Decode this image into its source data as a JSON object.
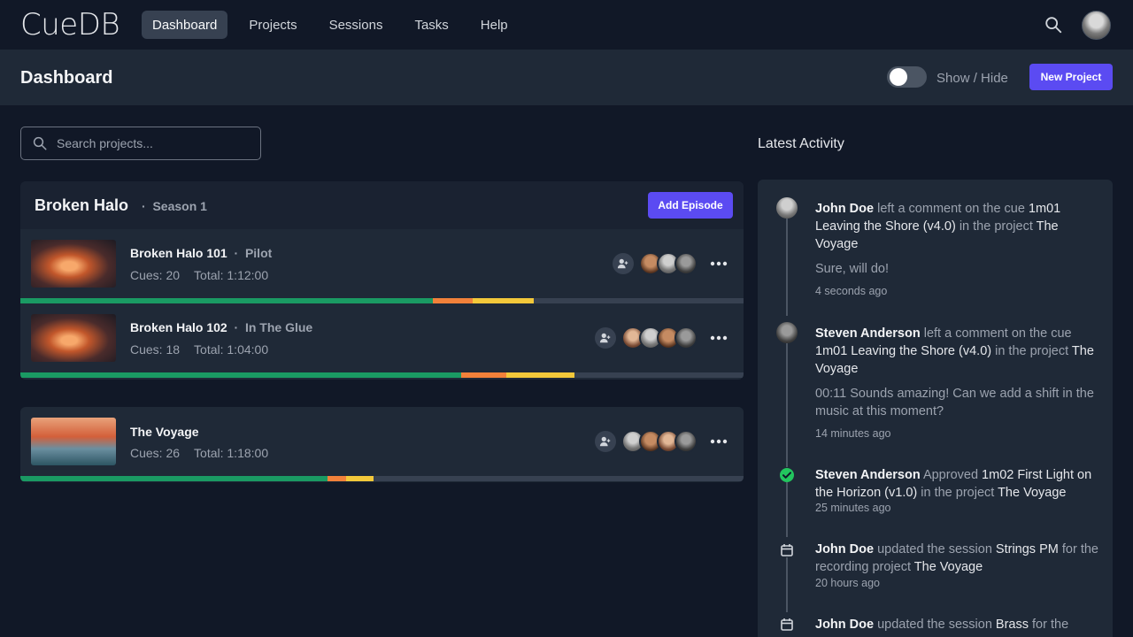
{
  "app": {
    "logo": "CueDB",
    "nav": [
      "Dashboard",
      "Projects",
      "Sessions",
      "Tasks",
      "Help"
    ],
    "active_nav": "Dashboard"
  },
  "header": {
    "title": "Dashboard",
    "toggle_label": "Show / Hide",
    "new_project": "New Project"
  },
  "search": {
    "placeholder": "Search projects..."
  },
  "projects": [
    {
      "title": "Broken Halo",
      "subtitle": "Season 1",
      "add_label": "Add Episode",
      "episodes": [
        {
          "name": "Broken Halo 101",
          "sub": "Pilot",
          "cues": "Cues: 20",
          "total": "Total: 1:12:00",
          "progress": {
            "green": 0.57,
            "orange": 0.056,
            "yellow": 0.084
          }
        },
        {
          "name": "Broken Halo 102",
          "sub": "In The Glue",
          "cues": "Cues: 18",
          "total": "Total: 1:04:00",
          "progress": {
            "green": 0.609,
            "orange": 0.063,
            "yellow": 0.094
          }
        }
      ]
    },
    {
      "title": "The Voyage",
      "episodes": [
        {
          "name": "The Voyage",
          "sub": "",
          "cues": "Cues: 26",
          "total": "Total: 1:18:00",
          "progress": {
            "green": 0.425,
            "orange": 0.025,
            "yellow": 0.038
          }
        }
      ]
    }
  ],
  "colors": {
    "green": "#1a9a63",
    "orange": "#f2813a",
    "yellow": "#f3c83a",
    "accent": "#5b4bf2"
  },
  "activity": {
    "title": "Latest Activity",
    "items": [
      {
        "user": "John Doe",
        "a1": " left a comment on the cue ",
        "h1": "1m01 Leaving the Shore (v4.0)",
        "a2": " in the project ",
        "h2": "The Voyage",
        "quote": "Sure, will do!",
        "time": "4 seconds ago",
        "icon": "avatar"
      },
      {
        "user": "Steven Anderson",
        "a1": " left a comment on the cue ",
        "h1": "1m01 Leaving the Shore (v4.0)",
        "a2": " in the project ",
        "h2": "The Voyage",
        "quote": "00:11 Sounds amazing! Can we add a shift in the music at this moment?",
        "time": "14 minutes ago",
        "icon": "avatar"
      },
      {
        "user": "Steven Anderson",
        "a1": " Approved ",
        "h1": "1m02 First Light on the Horizon (v1.0)",
        "a2": " in the project ",
        "h2": "The Voyage",
        "time": "25 minutes ago",
        "icon": "check-circle-icon"
      },
      {
        "user": "John Doe",
        "a1": " updated the session ",
        "h1": "Strings PM",
        "a2": " for the recording project ",
        "h2": "The Voyage",
        "time": "20 hours ago",
        "icon": "calendar-icon"
      },
      {
        "user": "John Doe",
        "a1": " updated the session ",
        "h1": "Brass",
        "a2": " for the",
        "h2": "",
        "time": "",
        "icon": "calendar-icon"
      }
    ]
  }
}
